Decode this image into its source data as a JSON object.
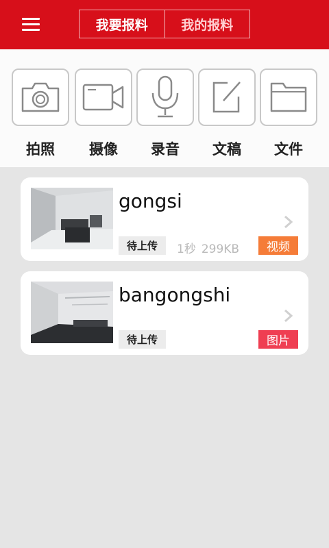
{
  "header": {
    "tabs": [
      {
        "label": "我要报料",
        "active": true
      },
      {
        "label": "我的报料",
        "active": false
      }
    ],
    "menu_icon": "menu-icon",
    "accent_color": "#d70f1a"
  },
  "tools": [
    {
      "label": "拍照",
      "icon": "camera-icon"
    },
    {
      "label": "摄像",
      "icon": "video-camera-icon"
    },
    {
      "label": "录音",
      "icon": "microphone-icon"
    },
    {
      "label": "文稿",
      "icon": "edit-icon"
    },
    {
      "label": "文件",
      "icon": "folder-icon"
    }
  ],
  "items": [
    {
      "title": "gongsi",
      "status": "待上传",
      "duration": "1秒",
      "size": "299KB",
      "type": "视频",
      "type_color": "#f57c38"
    },
    {
      "title": "bangongshi",
      "status": "待上传",
      "type": "图片",
      "type_color": "#ef3e52"
    }
  ]
}
